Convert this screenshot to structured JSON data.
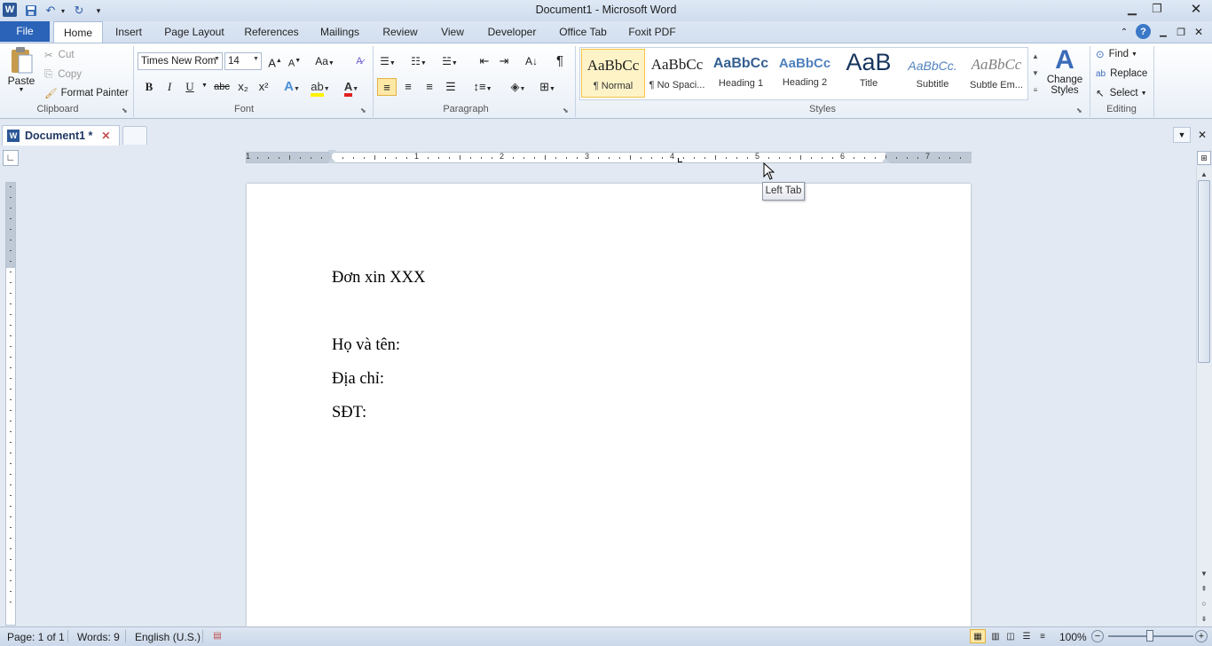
{
  "window": {
    "title": "Document1  -  Microsoft Word",
    "app_icon_letter": "W"
  },
  "ribbon_tabs": [
    "File",
    "Home",
    "Insert",
    "Page Layout",
    "References",
    "Mailings",
    "Review",
    "View",
    "Developer",
    "Office Tab",
    "Foxit PDF"
  ],
  "clipboard": {
    "paste": "Paste",
    "cut": "Cut",
    "copy": "Copy",
    "format_painter": "Format Painter",
    "group_label": "Clipboard"
  },
  "font": {
    "family": "Times New Rom",
    "size": "14",
    "change_case": "Aa",
    "bold": "B",
    "italic": "I",
    "underline": "U",
    "strikethrough": "abc",
    "subscript": "x₂",
    "superscript": "x²",
    "group_label": "Font"
  },
  "paragraph": {
    "group_label": "Paragraph",
    "pilcrow": "¶"
  },
  "styles": {
    "items": [
      {
        "sample": "AaBbCc",
        "name": "¶ Normal"
      },
      {
        "sample": "AaBbCc",
        "name": "¶ No Spaci..."
      },
      {
        "sample": "AaBbCc",
        "name": "Heading 1"
      },
      {
        "sample": "AaBbCc",
        "name": "Heading 2"
      },
      {
        "sample": "AaB",
        "name": "Title"
      },
      {
        "sample": "AaBbCc.",
        "name": "Subtitle"
      },
      {
        "sample": "AaBbCc",
        "name": "Subtle Em..."
      }
    ],
    "change_styles": "Change Styles",
    "group_label": "Styles",
    "colors": {
      "heading": "#365f91",
      "title": "#17365d",
      "subtitle": "#4f81bd",
      "accent": "#f6c343"
    }
  },
  "editing": {
    "find": "Find",
    "replace": "Replace",
    "select": "Select",
    "group_label": "Editing"
  },
  "document_tab": {
    "name": "Document1 *"
  },
  "ruler_numbers": [
    "1",
    "1",
    "2",
    "3",
    "4",
    "5",
    "6",
    "7"
  ],
  "tooltip": "Left Tab",
  "document": {
    "lines": [
      "Đơn xin XXX",
      "Họ và tên:",
      "Địa chỉ:",
      "SĐT:"
    ]
  },
  "status": {
    "page": "Page: 1 of 1",
    "words": "Words: 9",
    "language": "English (U.S.)",
    "zoom": "100%"
  }
}
